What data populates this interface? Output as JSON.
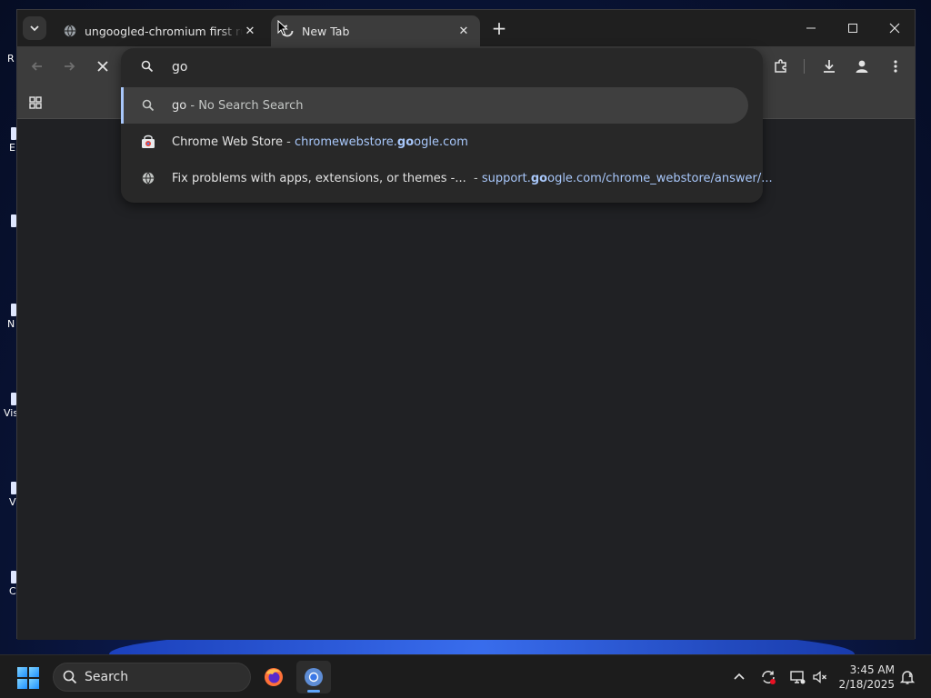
{
  "desktop": {
    "icon_labels": [
      "R",
      "E",
      "N",
      "Vis",
      "V",
      "C"
    ]
  },
  "browser": {
    "tabs": [
      {
        "title": "ungoogled-chromium first run page",
        "active": false,
        "favicon": "globe-icon"
      },
      {
        "title": "New Tab",
        "active": true,
        "favicon": "loading-spinner-icon"
      }
    ],
    "omnibox": {
      "input_value": "go",
      "suggestions": [
        {
          "icon": "search-icon",
          "primary": "go",
          "separator": " - ",
          "secondary": "No Search Search",
          "selected": true
        },
        {
          "icon": "chrome-web-store-icon",
          "primary": "Chrome Web Store",
          "separator": " - ",
          "url_pre": "chromewebstore.",
          "url_match": "go",
          "url_post": "ogle.com",
          "selected": false
        },
        {
          "icon": "globe-icon",
          "primary": "Fix problems with apps, extensions, or themes -...",
          "separator": "  - ",
          "url_pre": "support.",
          "url_match": "go",
          "url_post": "ogle.com/chrome_webstore/answer/...",
          "selected": false
        }
      ]
    }
  },
  "taskbar": {
    "search_label": "Search",
    "time": "3:45 AM",
    "date": "2/18/2025"
  },
  "colors": {
    "accent": "#a8c7fa",
    "toolbar": "#3c3c3c",
    "content": "#202124"
  }
}
